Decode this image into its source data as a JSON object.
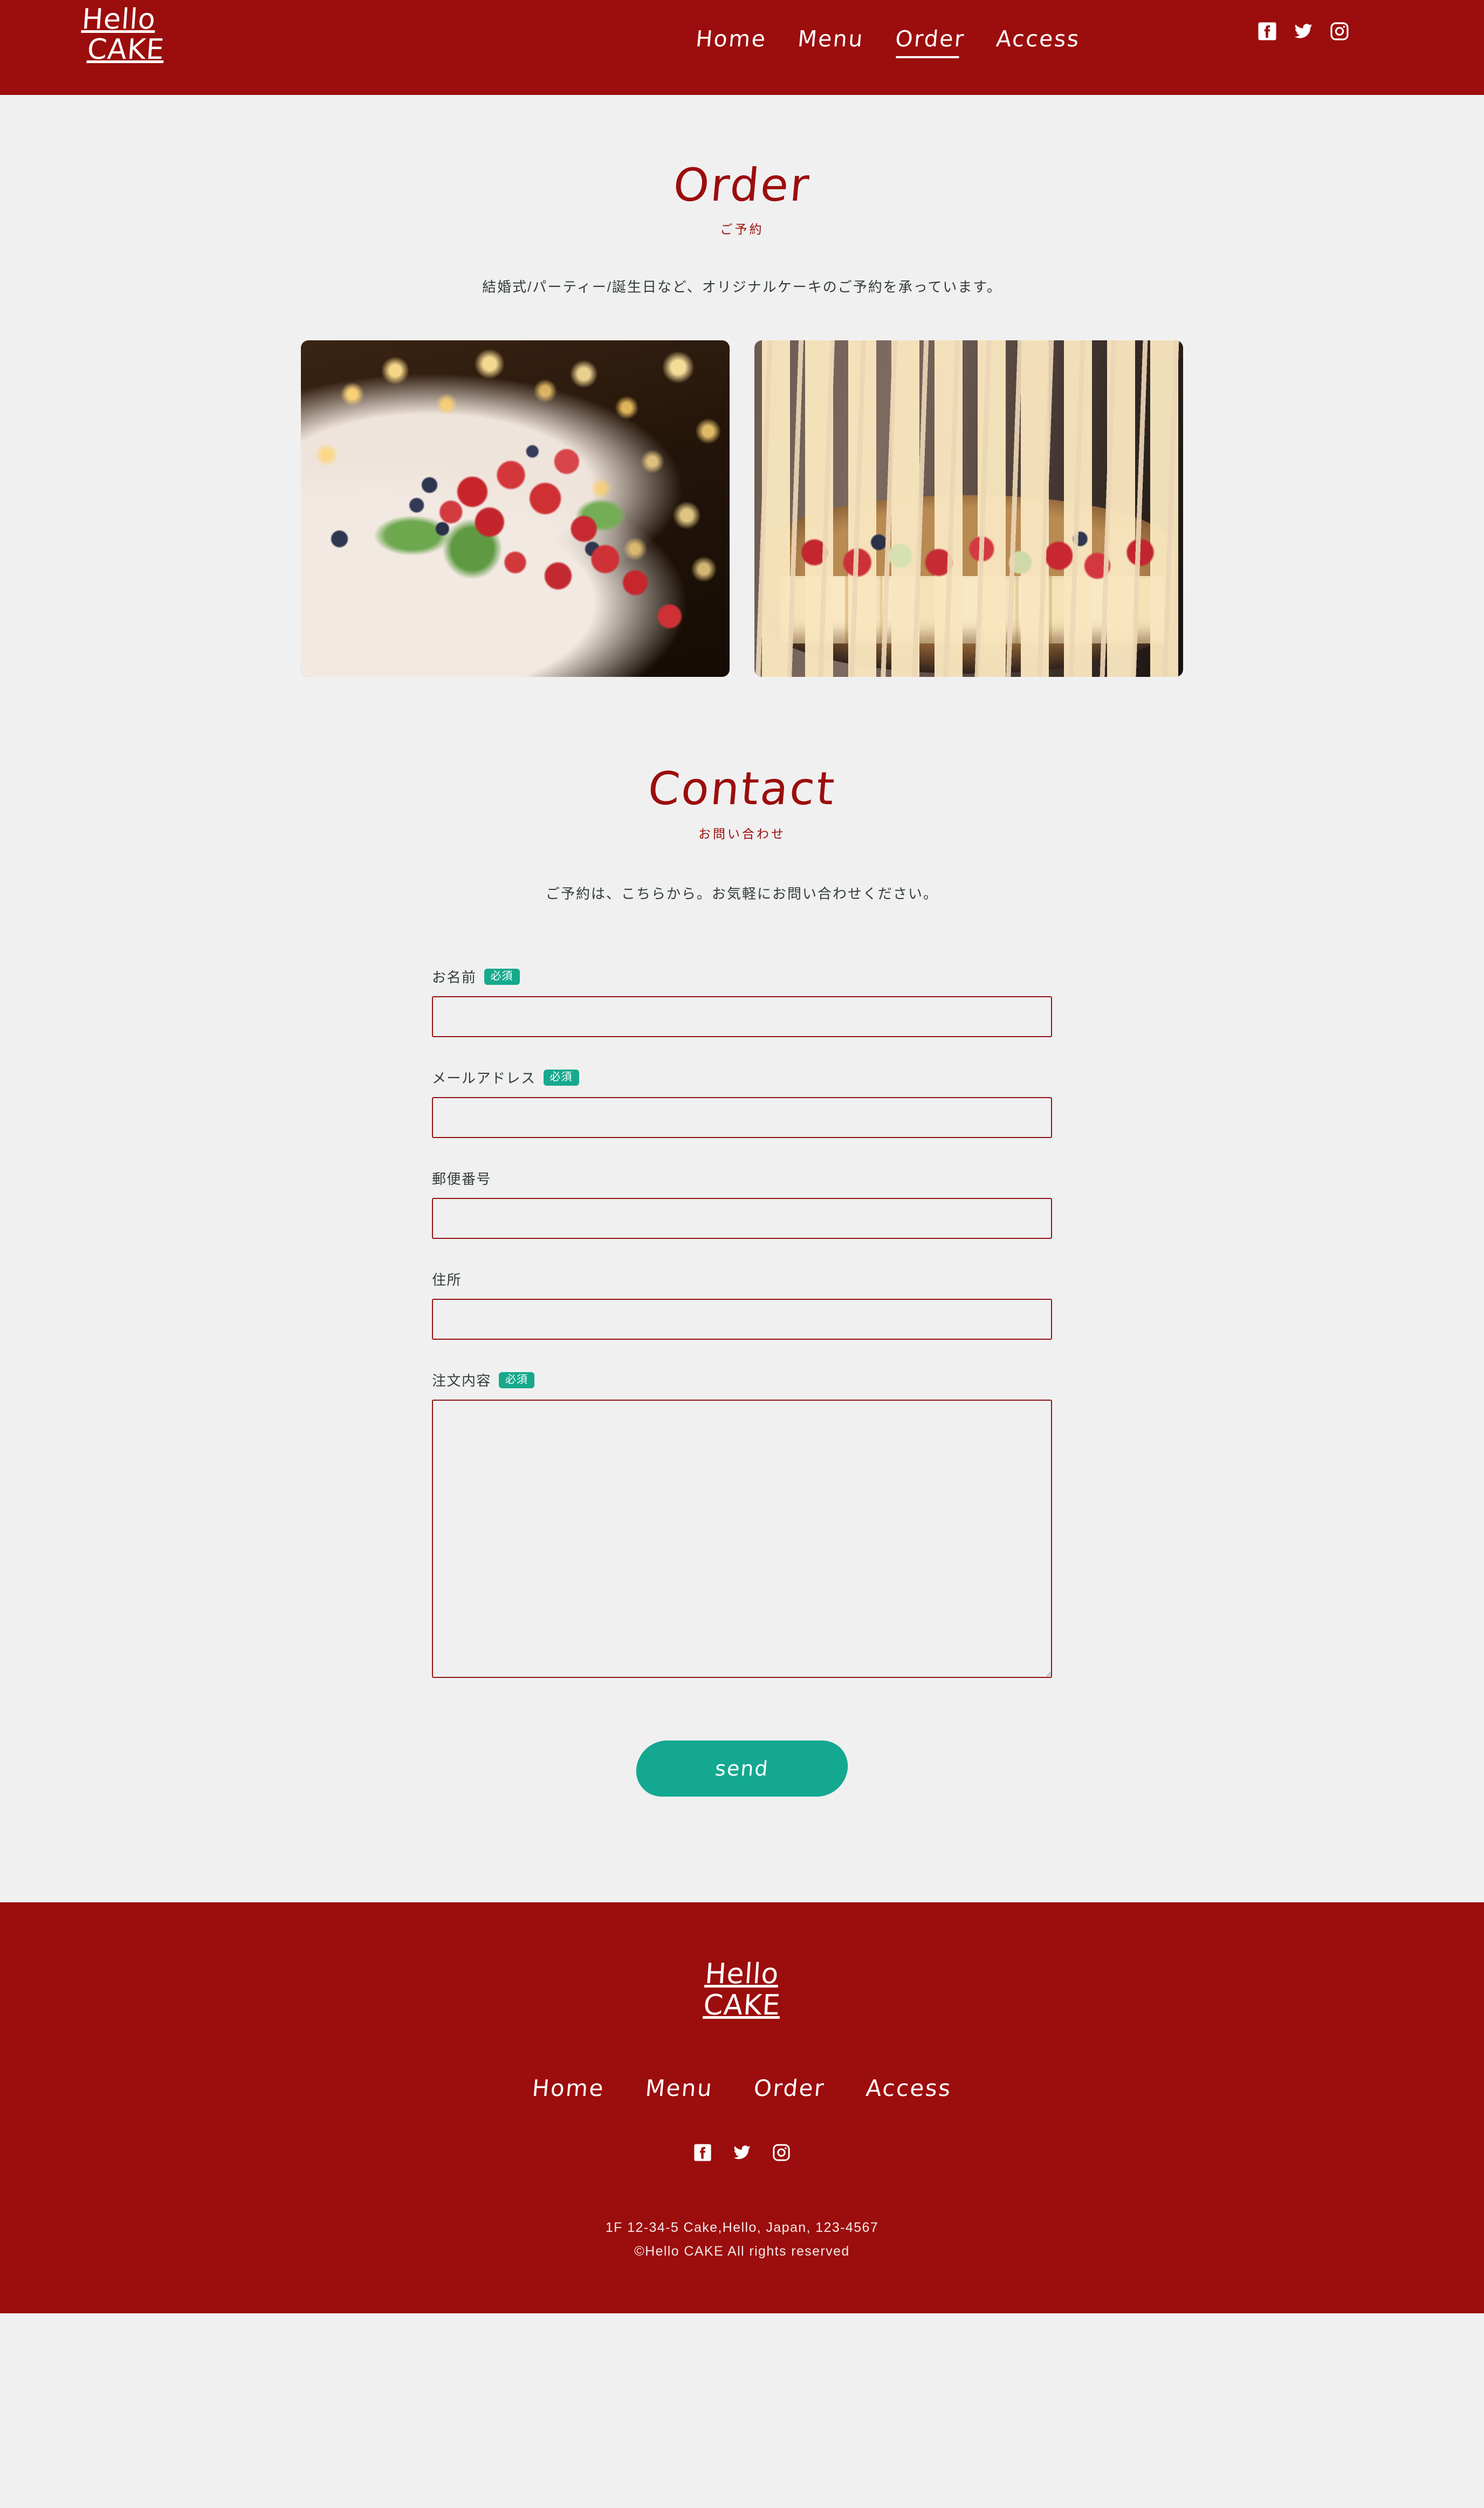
{
  "colors": {
    "brand_red": "#9c0d0d",
    "border_red": "#8e1313",
    "accent_teal": "#14a891",
    "badge_teal": "#16a98c",
    "page_background": "#f0f0f0",
    "body_text": "#333b3b"
  },
  "header": {
    "brand_line1": "Hello",
    "brand_line2": "CAKE",
    "nav": [
      {
        "label": "Home",
        "active": false
      },
      {
        "label": "Menu",
        "active": false
      },
      {
        "label": "Order",
        "active": true
      },
      {
        "label": "Access",
        "active": false
      }
    ],
    "social": [
      {
        "name": "facebook-icon",
        "label": "Facebook"
      },
      {
        "name": "twitter-icon",
        "label": "Twitter"
      },
      {
        "name": "instagram-icon",
        "label": "Instagram"
      }
    ]
  },
  "order": {
    "title": "Order",
    "subtitle": "ご予約",
    "lead": "結婚式/パーティー/誕生日など、オリジナルケーキのご予約を承っています。",
    "gallery": [
      {
        "name": "wedding-cake-photo",
        "alt": "いちごと生クリームの2段ウェディングケーキ"
      },
      {
        "name": "dessert-skewers-photo",
        "alt": "ピックを刺したフルーツデザートの盛り合わせ"
      }
    ]
  },
  "contact": {
    "title": "Contact",
    "subtitle": "お問い合わせ",
    "lead": "ご予約は、こちらから。お気軽にお問い合わせください。",
    "required_badge": "必須",
    "fields": [
      {
        "label": "お名前",
        "required": true,
        "type": "text",
        "value": "",
        "placeholder": ""
      },
      {
        "label": "メールアドレス",
        "required": true,
        "type": "text",
        "value": "",
        "placeholder": ""
      },
      {
        "label": "郵便番号",
        "required": false,
        "type": "text",
        "value": "",
        "placeholder": ""
      },
      {
        "label": "住所",
        "required": false,
        "type": "text",
        "value": "",
        "placeholder": ""
      },
      {
        "label": "注文内容",
        "required": true,
        "type": "textarea",
        "value": "",
        "placeholder": ""
      }
    ],
    "submit_label": "send"
  },
  "footer": {
    "brand_line1": "Hello",
    "brand_line2": "CAKE",
    "nav": [
      {
        "label": "Home"
      },
      {
        "label": "Menu"
      },
      {
        "label": "Order"
      },
      {
        "label": "Access"
      }
    ],
    "social": [
      {
        "name": "facebook-icon",
        "label": "Facebook"
      },
      {
        "name": "twitter-icon",
        "label": "Twitter"
      },
      {
        "name": "instagram-icon",
        "label": "Instagram"
      }
    ],
    "address": "1F 12-34-5 Cake,Hello, Japan, 123-4567",
    "copyright": "©Hello CAKE All rights reserved"
  }
}
